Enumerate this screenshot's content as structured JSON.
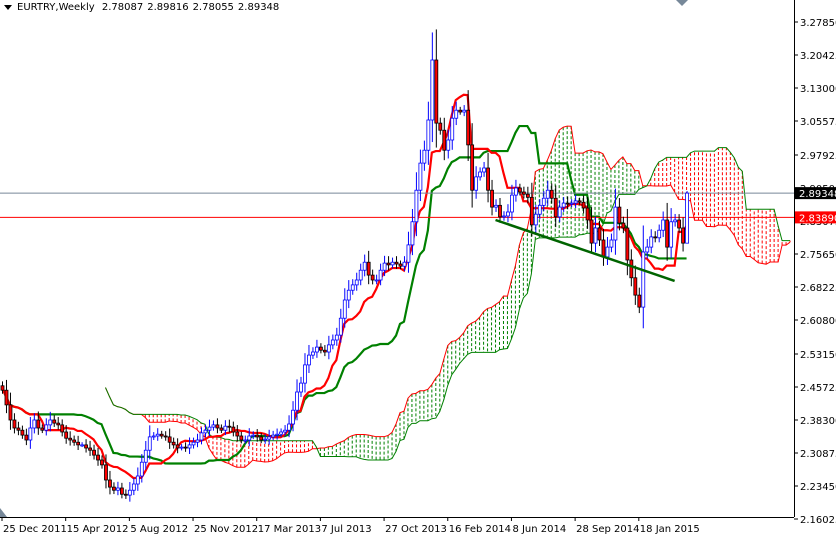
{
  "header": {
    "symbol_timeframe": "EURTRY,Weekly",
    "open": "2.78087",
    "high": "2.89816",
    "low": "2.78055",
    "close": "2.89348"
  },
  "chart_data": {
    "type": "candlestick",
    "title": "EURTRY,Weekly",
    "indicator": "Ichimoku Kinko Hyo (9, 26, 52)",
    "ylim": [
      2.16025,
      3.2785
    ],
    "y_ticks": [
      "3.27850",
      "3.20425",
      "3.13000",
      "3.05575",
      "2.97925",
      "2.90500",
      "2.83075",
      "2.75650",
      "2.68225",
      "2.60800",
      "2.53150",
      "2.45725",
      "2.38300",
      "2.30875",
      "2.23450",
      "2.16025"
    ],
    "x_tick_labels": [
      "25 Dec 2011",
      "15 Apr 2012",
      "5 Aug 2012",
      "25 Nov 2012",
      "17 Mar 2013",
      "7 Jul 2013",
      "27 Oct 2013",
      "16 Feb 2014",
      "8 Jun 2014",
      "28 Sep 2014",
      "18 Jan 2015"
    ],
    "x_tick_every_weeks": 16,
    "weekly_close": [
      2.45,
      2.417,
      2.383,
      2.365,
      2.36,
      2.349,
      2.338,
      2.365,
      2.383,
      2.365,
      2.36,
      2.372,
      2.383,
      2.376,
      2.372,
      2.356,
      2.342,
      2.338,
      2.333,
      2.327,
      2.327,
      2.32,
      2.315,
      2.304,
      2.293,
      2.282,
      2.248,
      2.232,
      2.225,
      2.23,
      2.216,
      2.214,
      2.225,
      2.239,
      2.257,
      2.288,
      2.315,
      2.345,
      2.347,
      2.351,
      2.347,
      2.345,
      2.333,
      2.327,
      2.32,
      2.322,
      2.32,
      2.327,
      2.333,
      2.338,
      2.354,
      2.36,
      2.367,
      2.372,
      2.365,
      2.36,
      2.369,
      2.367,
      2.356,
      2.347,
      2.338,
      2.338,
      2.347,
      2.349,
      2.345,
      2.338,
      2.34,
      2.345,
      2.349,
      2.351,
      2.356,
      2.36,
      2.374,
      2.405,
      2.446,
      2.466,
      2.507,
      2.529,
      2.536,
      2.547,
      2.54,
      2.536,
      2.552,
      2.563,
      2.574,
      2.612,
      2.653,
      2.675,
      2.687,
      2.698,
      2.72,
      2.738,
      2.709,
      2.698,
      2.698,
      2.72,
      2.736,
      2.732,
      2.738,
      2.734,
      2.729,
      2.738,
      2.777,
      2.829,
      2.9,
      2.961,
      2.99,
      3.058,
      3.193,
      3.051,
      3.035,
      2.99,
      3.013,
      3.062,
      3.08,
      3.076,
      3.08,
      3.002,
      2.9,
      2.93,
      2.941,
      2.95,
      2.9,
      2.862,
      2.866,
      2.84,
      2.842,
      2.851,
      2.889,
      2.905,
      2.896,
      2.891,
      2.884,
      2.822,
      2.846,
      2.866,
      2.882,
      2.9,
      2.882,
      2.84,
      2.862,
      2.871,
      2.869,
      2.871,
      2.876,
      2.873,
      2.86,
      2.833,
      2.781,
      2.815,
      2.788,
      2.75,
      2.772,
      2.788,
      2.862,
      2.826,
      2.815,
      2.743,
      2.703,
      2.664,
      2.637,
      2.761,
      2.772,
      2.795,
      2.793,
      2.81,
      2.833,
      2.772,
      2.829,
      2.833,
      2.815,
      2.781,
      2.89348
    ],
    "last_bar": {
      "open": 2.78087,
      "high": 2.89816,
      "low": 2.78055,
      "close": 2.89348
    },
    "bid_line": {
      "value": 2.89348,
      "label": "2.89348",
      "color": "#778899"
    },
    "level_line": {
      "value": 2.8389,
      "label": "2.83890",
      "color": "#ff0000"
    },
    "trendline": {
      "start": {
        "bar": 124,
        "price": 2.833
      },
      "end": {
        "bar": 169,
        "price": 2.696
      },
      "color": "#006400"
    },
    "colors": {
      "bull": "#0000ff",
      "bear_body": "#ff0000",
      "bear_wick": "#000000",
      "tenkan": "#ff0000",
      "kijun": "#008000",
      "span_a": "#ff0000",
      "span_b": "#008000",
      "cloud_up": "#008000",
      "cloud_down": "#ff0000"
    }
  }
}
